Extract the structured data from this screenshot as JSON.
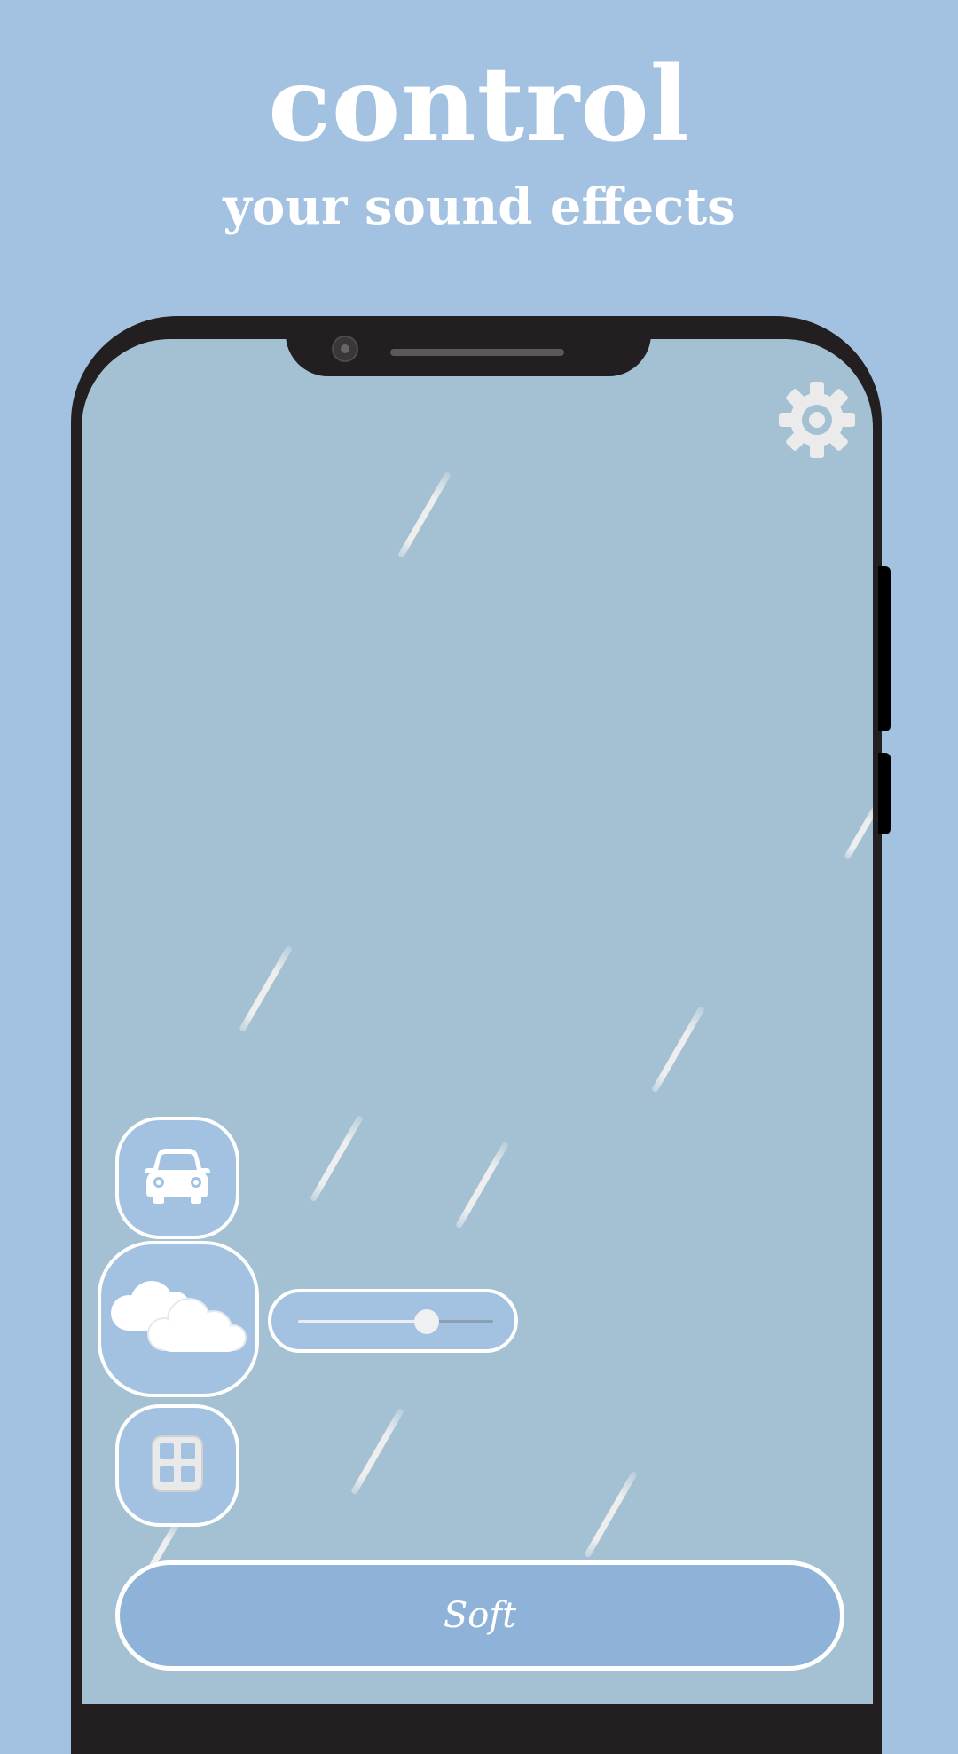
{
  "header": {
    "title": "control",
    "subtitle": "your sound effects"
  },
  "settings": {
    "icon": "gear-icon"
  },
  "sound_buttons": [
    {
      "icon": "car-icon"
    },
    {
      "icon": "cloud-icon"
    },
    {
      "icon": "window-icon"
    }
  ],
  "volume_slider": {
    "value_fraction": 0.66
  },
  "mode_button": {
    "label": "Soft"
  },
  "colors": {
    "background": "#a3c2e1",
    "screen": "#a4c1d3",
    "phone_frame": "#231f20",
    "button_fill": "#a3c2e1",
    "mode_button_fill": "#8fb3d8",
    "accent": "#ffffff"
  }
}
